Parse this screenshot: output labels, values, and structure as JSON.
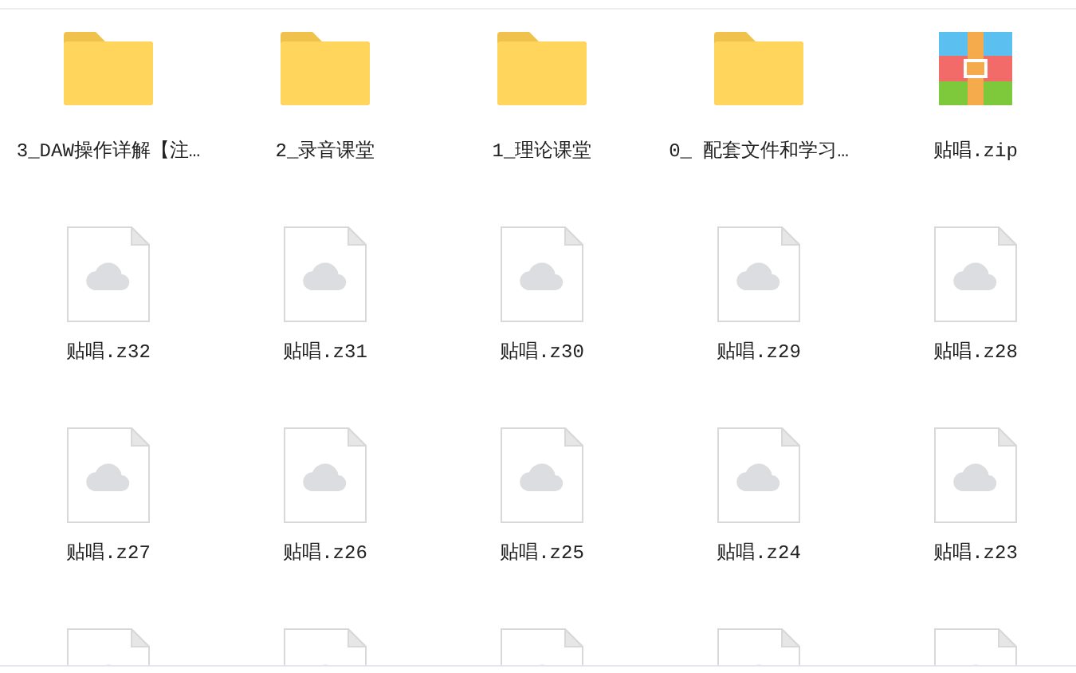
{
  "items": [
    {
      "kind": "folder",
      "label": "3_DAW操作详解【注…"
    },
    {
      "kind": "folder",
      "label": "2_录音课堂"
    },
    {
      "kind": "folder",
      "label": "1_理论课堂"
    },
    {
      "kind": "folder",
      "label": "0_ 配套文件和学习…"
    },
    {
      "kind": "archive",
      "label": "贴唱.zip"
    },
    {
      "kind": "file",
      "label": "贴唱.z32"
    },
    {
      "kind": "file",
      "label": "贴唱.z31"
    },
    {
      "kind": "file",
      "label": "贴唱.z30"
    },
    {
      "kind": "file",
      "label": "贴唱.z29"
    },
    {
      "kind": "file",
      "label": "贴唱.z28"
    },
    {
      "kind": "file",
      "label": "贴唱.z27"
    },
    {
      "kind": "file",
      "label": "贴唱.z26"
    },
    {
      "kind": "file",
      "label": "贴唱.z25"
    },
    {
      "kind": "file",
      "label": "贴唱.z24"
    },
    {
      "kind": "file",
      "label": "贴唱.z23"
    },
    {
      "kind": "file"
    },
    {
      "kind": "file"
    },
    {
      "kind": "file"
    },
    {
      "kind": "file"
    },
    {
      "kind": "file"
    }
  ]
}
